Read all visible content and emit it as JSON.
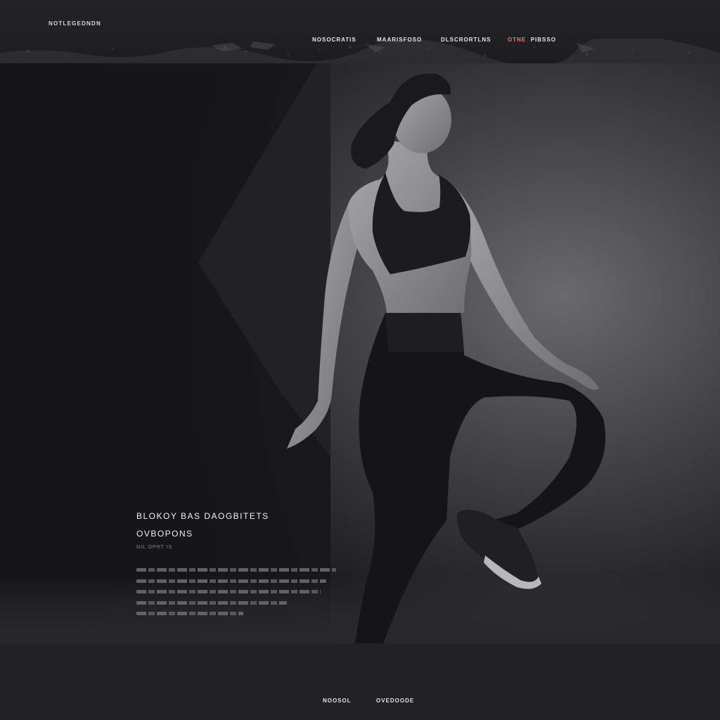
{
  "header": {
    "logo_text": "NOTLEGEDNDN",
    "nav": [
      {
        "label": "NOSOCRATIS"
      },
      {
        "label": "MAARISFOSO"
      },
      {
        "label": "DLSCRORTLNS"
      },
      {
        "label_accent": "OTNE",
        "label_rest": "PIBSSO"
      }
    ]
  },
  "hero": {
    "headline_line1": "BLOKOY BAS DAOGBITETS",
    "headline_line2": "OVBOPONS",
    "subline": "NIL OPRT IS"
  },
  "footer": {
    "links": [
      {
        "label": "NOOSOL"
      },
      {
        "label": "OVEDOODE"
      }
    ]
  },
  "colors": {
    "background": "#1f1f22",
    "hero_dark": "#17171a",
    "hero_light": "#6a6a6d",
    "accent": "#d8846e",
    "text_primary": "#f2f2f2"
  }
}
